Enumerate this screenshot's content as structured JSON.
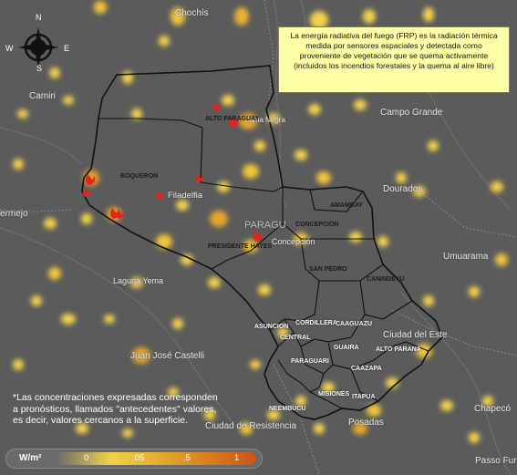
{
  "map": {
    "info_box": "La energía radiativa del fuego (FRP) es la radiación térmica medida por sensores espaciales y detectada como proveniente de vegetación que se quema activamente (incluidos los incendios forestales y la quema al aire libre)",
    "note": "*Las concentraciones expresadas corresponden a pronósticos, llamados \"antecedentes\" valores, es decir, valores cercanos a la superficie.",
    "compass": {
      "n": "N",
      "s": "S",
      "e": "E",
      "w": "W"
    },
    "legend": {
      "unit": "W/m²",
      "ticks": [
        "0",
        ".05",
        ".5",
        "1"
      ]
    },
    "cities": {
      "chochis": "Chochís",
      "camiri": "Camiri",
      "campo_grande": "Campo Grande",
      "dourados": "Dourados",
      "bermejo": "ermejo",
      "umuarama": "Umuarama",
      "laguna_yema": "Laguna Yema",
      "juan_jose_castelli": "Juan José Castelli",
      "ciudad_del_este": "Ciudad del Este",
      "posadas": "Posadas",
      "chapeco": "Chapecó",
      "ciudad_resistencia": "Ciudad de Resistencia",
      "passo_fundo": "Passo Fund",
      "bahia_negra": "Bahía Negra",
      "filadelfia": "Filadelfia",
      "concepcion_city": "Concepción",
      "paraguay": "PARAGU"
    },
    "departments": {
      "alto_paraguay": "ALTO PARAGUAY",
      "boqueron": "BOQUERON",
      "presidente_hayes": "PRESIDENTE HAYES",
      "amambay": "AMAMBAY",
      "concepcion": "CONCEPCION",
      "san_pedro": "SAN PEDRO",
      "canindeyu": "CANINDEYU",
      "asuncion": "ASUNCION",
      "cordillera": "CORDILLERA",
      "caaguazu": "CAAGUAZU",
      "central": "CENTRAL",
      "guaira": "GUAIRA",
      "alto_parana": "ALTO PARANA",
      "paraguari": "PARAGUARI",
      "caazapa": "CAAZAPA",
      "misiones": "MISIONES",
      "itapua": "ITAPUA",
      "neembucu": "NEEMBUCU"
    }
  }
}
